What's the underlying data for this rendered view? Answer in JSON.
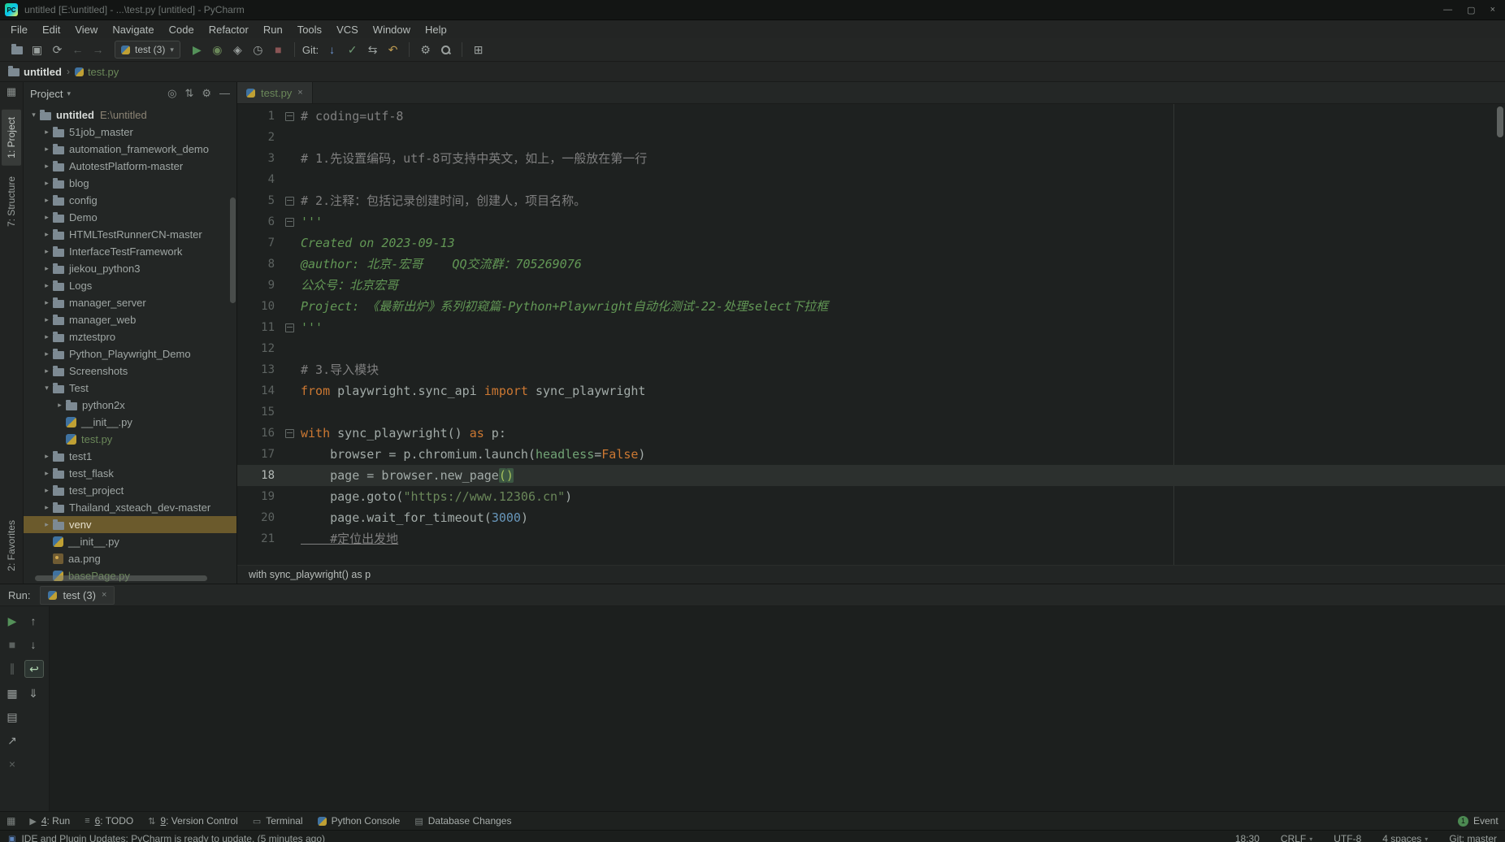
{
  "window": {
    "title": "untitled [E:\\untitled] - ...\\test.py [untitled] - PyCharm",
    "logo": "PC"
  },
  "glyphs": {
    "caret_down": "▾",
    "chevron": "›",
    "expanded": "▾",
    "collapsed": "▸",
    "close": "×",
    "minimize": "—",
    "maximize": "▢",
    "grid": "▦",
    "status_icon": "▣"
  },
  "palette": {
    "bg-app": "#161817",
    "bg-title": "#131514",
    "bg-menu": "#232524",
    "bg-toolbar": "#242625",
    "bg-panel": "#232625",
    "bg-editor": "#1e2120",
    "bg-console": "#1c1f1e",
    "comment": "#7f7f7f",
    "docstring": "#629755",
    "keyword": "#cc7832",
    "string": "#6a8759",
    "number": "#6897bb",
    "kwarg": "#71a375",
    "match": "#a5c25c",
    "green-file": "#6a8759",
    "selection": "#6b5a2c",
    "current-line": "#2c302e",
    "accent-run": "#549159"
  },
  "menu": {
    "items": [
      "File",
      "Edit",
      "View",
      "Navigate",
      "Code",
      "Refactor",
      "Run",
      "Tools",
      "VCS",
      "Window",
      "Help"
    ]
  },
  "toolbar": {
    "run_config": "test (3)",
    "items": [
      {
        "name": "open-icon",
        "type": "folder"
      },
      {
        "name": "save-icon",
        "glyph": "▣"
      },
      {
        "name": "sync-icon",
        "glyph": "⟳"
      },
      {
        "name": "back-icon",
        "glyph": "←",
        "dim": true
      },
      {
        "name": "forward-icon",
        "glyph": "→",
        "dim": true
      },
      {
        "type": "combo"
      },
      {
        "name": "run-icon",
        "glyph": "▶",
        "color": "#549159"
      },
      {
        "name": "debug-icon",
        "glyph": "◉",
        "color": "#6a8759"
      },
      {
        "name": "coverage-icon",
        "glyph": "◈"
      },
      {
        "name": "profiler-icon",
        "glyph": "◷"
      },
      {
        "name": "stop-icon",
        "glyph": "■",
        "color": "#8a5555"
      },
      {
        "type": "sep"
      },
      {
        "type": "label",
        "text": "Git:",
        "name": "git-label"
      },
      {
        "name": "git-update-icon",
        "glyph": "↓",
        "color": "#6f96d2"
      },
      {
        "name": "git-commit-icon",
        "glyph": "✓",
        "color": "#6f9a74"
      },
      {
        "name": "git-compare-icon",
        "glyph": "⇆"
      },
      {
        "name": "git-rollback-icon",
        "glyph": "↶",
        "color": "#bd9b51"
      },
      {
        "type": "sep"
      },
      {
        "name": "wrench-icon",
        "glyph": "⚙"
      },
      {
        "name": "search-icon",
        "type": "search"
      },
      {
        "type": "sep"
      },
      {
        "name": "tool-windows-icon",
        "glyph": "⊞"
      }
    ]
  },
  "navbar": {
    "items": [
      {
        "label": "untitled",
        "icon": "folder"
      },
      {
        "label": "test.py",
        "icon": "python",
        "color": "green"
      }
    ]
  },
  "left_strip": {
    "top": [
      {
        "label": "1: Project",
        "active": true
      },
      {
        "label": "7: Structure"
      }
    ],
    "bottom": [
      {
        "label": "2: Favorites"
      }
    ]
  },
  "project": {
    "title": "Project",
    "header_icons": [
      {
        "name": "locate-icon",
        "glyph": "◎"
      },
      {
        "name": "collapse-all-icon",
        "glyph": "⇅"
      },
      {
        "name": "settings-gear-icon",
        "glyph": "⚙"
      },
      {
        "name": "hide-panel-icon",
        "glyph": "—"
      }
    ],
    "tree": [
      {
        "label": "untitled",
        "suffix": "E:\\untitled",
        "type": "root",
        "indent": 0,
        "expanded": true,
        "bold": true
      },
      {
        "label": "51job_master",
        "type": "folder",
        "indent": 1
      },
      {
        "label": "automation_framework_demo",
        "type": "folder",
        "indent": 1
      },
      {
        "label": "AutotestPlatform-master",
        "type": "folder",
        "indent": 1
      },
      {
        "label": "blog",
        "type": "folder",
        "indent": 1
      },
      {
        "label": "config",
        "type": "folder",
        "indent": 1
      },
      {
        "label": "Demo",
        "type": "folder",
        "indent": 1
      },
      {
        "label": "HTMLTestRunnerCN-master",
        "type": "folder",
        "indent": 1
      },
      {
        "label": "InterfaceTestFramework",
        "type": "folder",
        "indent": 1
      },
      {
        "label": "jiekou_python3",
        "type": "folder",
        "indent": 1
      },
      {
        "label": "Logs",
        "type": "folder",
        "indent": 1
      },
      {
        "label": "manager_server",
        "type": "folder",
        "indent": 1
      },
      {
        "label": "manager_web",
        "type": "folder",
        "indent": 1
      },
      {
        "label": "mztestpro",
        "type": "folder",
        "indent": 1
      },
      {
        "label": "Python_Playwright_Demo",
        "type": "folder",
        "indent": 1
      },
      {
        "label": "Screenshots",
        "type": "folder",
        "indent": 1
      },
      {
        "label": "Test",
        "type": "folder",
        "indent": 1,
        "expanded": true
      },
      {
        "label": "python2x",
        "type": "folder",
        "indent": 2
      },
      {
        "label": "__init__.py",
        "type": "python",
        "indent": 2
      },
      {
        "label": "test.py",
        "type": "python",
        "indent": 2,
        "color": "green"
      },
      {
        "label": "test1",
        "type": "folder",
        "indent": 1
      },
      {
        "label": "test_flask",
        "type": "folder",
        "indent": 1
      },
      {
        "label": "test_project",
        "type": "folder",
        "indent": 1
      },
      {
        "label": "Thailand_xsteach_dev-master",
        "type": "folder",
        "indent": 1
      },
      {
        "label": "venv",
        "type": "folder",
        "indent": 1,
        "selected": true
      },
      {
        "label": "__init__.py",
        "type": "python",
        "indent": 1
      },
      {
        "label": "aa.png",
        "type": "image",
        "indent": 1
      },
      {
        "label": "basePage.py",
        "type": "python",
        "indent": 1,
        "color": "green"
      }
    ]
  },
  "editor": {
    "tab": {
      "label": "test.py"
    },
    "current_line": 18,
    "context_bar": "with sync_playwright() as p",
    "lines": [
      {
        "no": 1,
        "fold": true,
        "seg": [
          [
            "c",
            "# coding=utf-8"
          ]
        ]
      },
      {
        "no": 2,
        "seg": []
      },
      {
        "no": 3,
        "seg": [
          [
            "c",
            "# 1.先设置编码，utf-8可支持中英文，如上，一般放在第一行"
          ]
        ]
      },
      {
        "no": 4,
        "seg": []
      },
      {
        "no": 5,
        "fold": true,
        "seg": [
          [
            "c",
            "# 2.注释：包括记录创建时间，创建人，项目名称。"
          ]
        ]
      },
      {
        "no": 6,
        "fold": true,
        "seg": [
          [
            "d",
            "'''"
          ]
        ]
      },
      {
        "no": 7,
        "seg": [
          [
            "d",
            "Created on 2023-09-13"
          ]
        ]
      },
      {
        "no": 8,
        "seg": [
          [
            "d",
            "@author: 北京-宏哥    QQ交流群：705269076"
          ]
        ]
      },
      {
        "no": 9,
        "seg": [
          [
            "d",
            "公众号：北京宏哥"
          ]
        ]
      },
      {
        "no": 10,
        "seg": [
          [
            "d",
            "Project: 《最新出炉》系列初窥篇-Python+Playwright自动化测试-22-处理select下拉框"
          ]
        ]
      },
      {
        "no": 11,
        "fold": true,
        "seg": [
          [
            "d",
            "'''"
          ]
        ]
      },
      {
        "no": 12,
        "seg": []
      },
      {
        "no": 13,
        "seg": [
          [
            "c",
            "# 3.导入模块"
          ]
        ]
      },
      {
        "no": 14,
        "seg": [
          [
            "k",
            "from"
          ],
          [
            "p",
            " playwright.sync_api "
          ],
          [
            "k",
            "import"
          ],
          [
            "p",
            " sync_playwright"
          ]
        ]
      },
      {
        "no": 15,
        "seg": []
      },
      {
        "no": 16,
        "fold": true,
        "seg": [
          [
            "k",
            "with"
          ],
          [
            "p",
            " sync_playwright() "
          ],
          [
            "k",
            "as"
          ],
          [
            "p",
            " p:"
          ]
        ]
      },
      {
        "no": 17,
        "seg": [
          [
            "p",
            "    browser = p.chromium.launch("
          ],
          [
            "a",
            "headless"
          ],
          [
            "p",
            "="
          ],
          [
            "k",
            "False"
          ],
          [
            "p",
            ")"
          ]
        ]
      },
      {
        "no": 18,
        "seg": [
          [
            "p",
            "    page = browser.new_page"
          ],
          [
            "m",
            "("
          ],
          [
            "m",
            ")"
          ]
        ]
      },
      {
        "no": 19,
        "seg": [
          [
            "p",
            "    page.goto("
          ],
          [
            "s",
            "\"https://www.12306.cn\""
          ],
          [
            "p",
            ")"
          ]
        ]
      },
      {
        "no": 20,
        "seg": [
          [
            "p",
            "    page.wait_for_timeout("
          ],
          [
            "n",
            "3000"
          ],
          [
            "p",
            ")"
          ]
        ]
      },
      {
        "no": 21,
        "seg": [
          [
            "u",
            "    #定位出发地"
          ]
        ]
      }
    ]
  },
  "run_panel": {
    "label": "Run:",
    "tab": {
      "label": "test (3)"
    },
    "toolbar_a": [
      {
        "name": "rerun-icon",
        "glyph": "▶",
        "color": "#549159"
      },
      {
        "name": "stop-icon",
        "glyph": "■",
        "dim": true
      },
      {
        "name": "pause-output-icon",
        "glyph": "∥",
        "dim": true
      },
      {
        "name": "restore-layout-icon",
        "glyph": "▦"
      },
      {
        "name": "print-icon",
        "glyph": "▤"
      },
      {
        "name": "jump-to-source-icon",
        "glyph": "↗"
      },
      {
        "name": "clear-all-icon",
        "glyph": "×",
        "dim": true
      }
    ],
    "toolbar_b": [
      {
        "name": "prev-trace-icon",
        "glyph": "↑"
      },
      {
        "name": "next-trace-icon",
        "glyph": "↓"
      },
      {
        "name": "soft-wrap-icon",
        "glyph": "↩",
        "selected": true
      },
      {
        "name": "scroll-to-end-icon",
        "glyph": "⇓"
      }
    ]
  },
  "bottom_bar": {
    "icons": {
      "run": "▶",
      "todo": "≡",
      "vcs": "⇅",
      "terminal": "▭",
      "db": "▤"
    },
    "items": [
      {
        "mnemonic": "4",
        "label": "Run",
        "icon": "run"
      },
      {
        "mnemonic": "6",
        "label": "TODO",
        "icon": "todo"
      },
      {
        "mnemonic": "9",
        "label": "Version Control",
        "icon": "vcs"
      },
      {
        "label": "Terminal",
        "icon": "terminal"
      },
      {
        "label": "Python Console",
        "icon": "python"
      },
      {
        "label": "Database Changes",
        "icon": "db"
      }
    ],
    "event_log": {
      "badge": "1",
      "label": "Event Log"
    }
  },
  "status_bar": {
    "message": "IDE and Plugin Updates: PyCharm is ready to update. (5 minutes ago)",
    "items": [
      {
        "t": "18:30"
      },
      {
        "t": "CRLF",
        "caret": true
      },
      {
        "t": "UTF-8"
      },
      {
        "t": "4 spaces",
        "caret": true
      },
      {
        "t": "Git: master"
      }
    ]
  }
}
